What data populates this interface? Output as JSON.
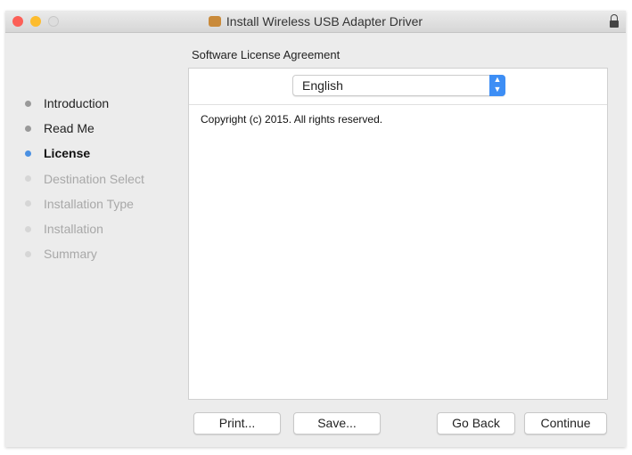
{
  "window": {
    "title": "Install Wireless USB Adapter Driver"
  },
  "section_title": "Software License Agreement",
  "steps": [
    {
      "label": "Introduction",
      "state": "done"
    },
    {
      "label": "Read Me",
      "state": "done"
    },
    {
      "label": "License",
      "state": "current"
    },
    {
      "label": "Destination Select",
      "state": "pending"
    },
    {
      "label": "Installation Type",
      "state": "pending"
    },
    {
      "label": "Installation",
      "state": "pending"
    },
    {
      "label": "Summary",
      "state": "pending"
    }
  ],
  "language_select": {
    "value": "English"
  },
  "license_text": "Copyright (c) 2015.  All rights reserved.",
  "buttons": {
    "print": "Print...",
    "save": "Save...",
    "go_back": "Go Back",
    "continue": "Continue"
  },
  "colors": {
    "accent": "#3d8ef5",
    "close": "#fc5f57",
    "minimize": "#fdbc2e"
  }
}
